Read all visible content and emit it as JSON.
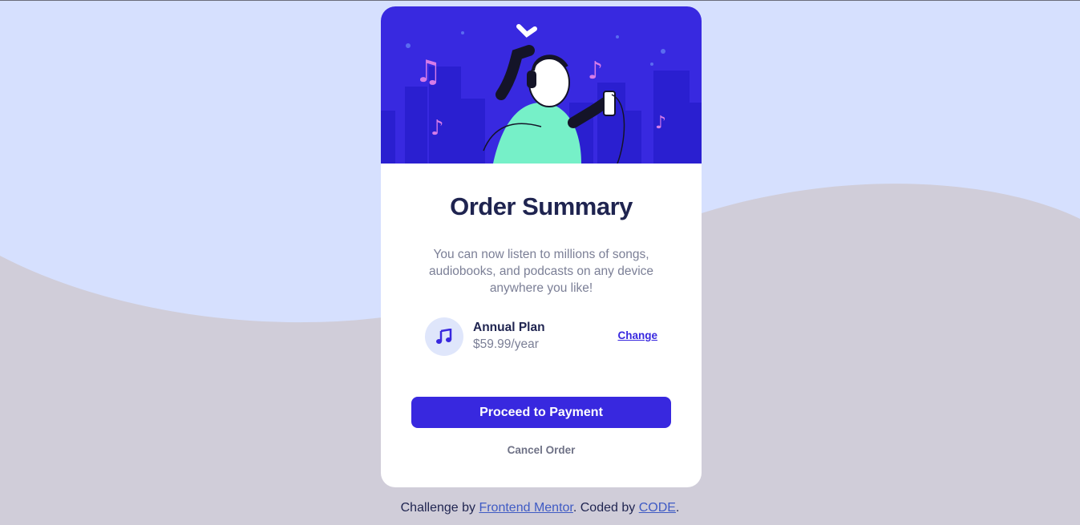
{
  "colors": {
    "page_bg": "#d0cdd9",
    "wave": "#d6e0fe",
    "primary": "#3828df",
    "title": "#1f2450",
    "muted": "#7b7f96",
    "hero_bg": "#3829e0",
    "hero_accent": "#76f0c8"
  },
  "hero": {
    "icon": "music-listener-illustration"
  },
  "card": {
    "title": "Order Summary",
    "description": "You can now listen to millions of songs, audiobooks, and podcasts on any device anywhere you like!"
  },
  "plan": {
    "icon": "music-note-icon",
    "name": "Annual Plan",
    "price": "$59.99/year",
    "change_label": "Change"
  },
  "actions": {
    "proceed_label": "Proceed to Payment",
    "cancel_label": "Cancel Order"
  },
  "footer": {
    "prefix": "Challenge by ",
    "mentor_link": "Frontend Mentor",
    "middle": ". Coded by ",
    "author_link": "CODE",
    "suffix": "."
  }
}
